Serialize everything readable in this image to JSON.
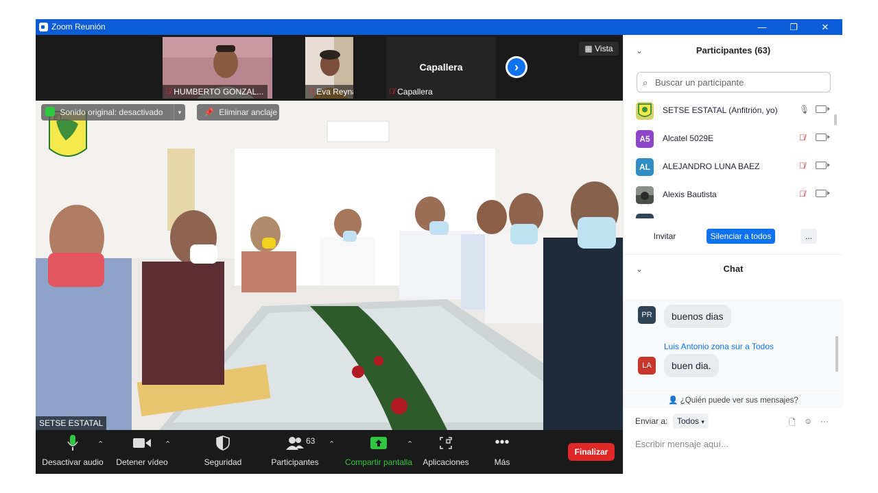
{
  "window": {
    "title": "Zoom Reunión",
    "controls": {
      "minimize": "—",
      "restore": "❐",
      "close": "✕"
    }
  },
  "strip": {
    "tiles": [
      {
        "name": "HUMBERTO GONZAL...",
        "muted": true,
        "kind": "video"
      },
      {
        "name": "Eva Reyna Ruíz",
        "muted": true,
        "kind": "video"
      },
      {
        "name": "Capallera",
        "muted": true,
        "kind": "name",
        "big_name": "Capallera"
      }
    ],
    "view_label": "Vista",
    "next_icon": "chevron-right-icon"
  },
  "main_video": {
    "active_speaker": "SETSE ESTATAL",
    "original_sound": "Sonido original: desactivado",
    "unpin": "Eliminar anclaje",
    "logo_text": "ET"
  },
  "toolbar": {
    "mute": "Desactivar audio",
    "video": "Detener vídeo",
    "security": "Seguridad",
    "participants": "Participantes",
    "participants_count": "63",
    "share": "Compartir pantalla",
    "apps": "Aplicaciones",
    "more": "Más",
    "end": "Finalizar",
    "colors": {
      "share_green": "#2fc840",
      "end_red": "#e02828"
    }
  },
  "participants_panel": {
    "title": "Participantes (63)",
    "search_placeholder": "Buscar un participante",
    "items": [
      {
        "name": "SETSE ESTATAL (Anfitrión, yo)",
        "avatar": "",
        "avatar_color": "#d8d36a",
        "mic": "on"
      },
      {
        "name": "Alcatel 5029E",
        "avatar": "A5",
        "avatar_color": "#8e44c9",
        "mic": "muted"
      },
      {
        "name": "ALEJANDRO LUNA BAEZ",
        "avatar": "AL",
        "avatar_color": "#2f8dc4",
        "mic": "muted"
      },
      {
        "name": "Alexis Bautista",
        "avatar": "",
        "avatar_color": "#4a4f4a",
        "mic": "muted"
      }
    ],
    "invite": "Invitar",
    "mute_all": "Silenciar a todos",
    "more": "..."
  },
  "chat_panel": {
    "title": "Chat",
    "messages": [
      {
        "avatar": "PR",
        "avatar_color": "#2f4557",
        "sender": "",
        "text": "buenos dias"
      },
      {
        "avatar": "LA",
        "avatar_color": "#c7352b",
        "sender": "Luis Antonio zona sur a Todos",
        "text": "buen dia."
      }
    ],
    "who_can_see": "¿Quién puede ver sus mensajes?",
    "send_to_label": "Enviar a:",
    "send_to_value": "Todos",
    "input_placeholder": "Escribir mensaje aquí..."
  }
}
